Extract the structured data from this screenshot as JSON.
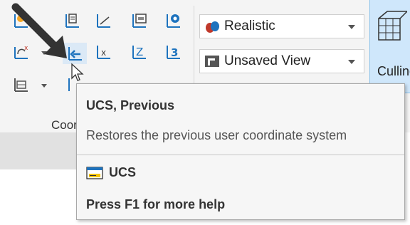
{
  "ribbon": {
    "coordinates_panel_label": "Coordinates",
    "visual_style": {
      "value": "Realistic"
    },
    "view": {
      "value": "Unsaved View"
    },
    "culling_label": "Culling"
  },
  "tooltip": {
    "title": "UCS, Previous",
    "description": "Restores the previous user coordinate system",
    "command": "UCS",
    "help": "Press F1 for more help"
  },
  "icons": {
    "world_ucs": "ucs-world-icon",
    "ucs_previous": "ucs-previous-icon",
    "rotate_x": "ucs-x-icon",
    "rotate_z": "ucs-z-icon",
    "three_point": "ucs-3point-icon",
    "command": "ucs-command-icon"
  },
  "colors": {
    "accent_blue": "#1e73be",
    "highlight": "#cfe7fb",
    "orange": "#f5a623"
  }
}
